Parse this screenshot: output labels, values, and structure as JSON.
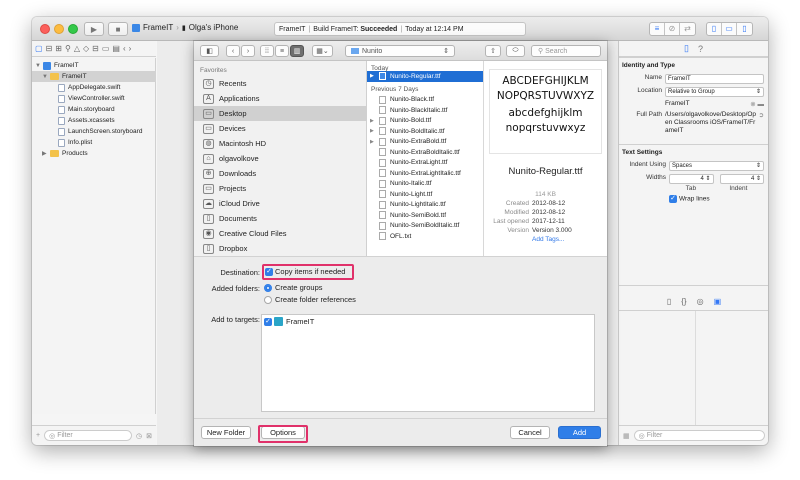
{
  "toolbar": {
    "scheme_app": "FrameIT",
    "scheme_device": "Olga's iPhone",
    "status_project": "FrameIT",
    "status_build": "Build FrameIT: ",
    "status_result": "Succeeded",
    "status_time": "Today at 12:14 PM"
  },
  "navigator": {
    "items": [
      {
        "label": "FrameIT",
        "kind": "project"
      },
      {
        "label": "FrameIT",
        "kind": "folder"
      },
      {
        "label": "AppDelegate.swift",
        "kind": "file"
      },
      {
        "label": "ViewController.swift",
        "kind": "file"
      },
      {
        "label": "Main.storyboard",
        "kind": "file"
      },
      {
        "label": "Assets.xcassets",
        "kind": "file"
      },
      {
        "label": "LaunchScreen.storyboard",
        "kind": "file"
      },
      {
        "label": "Info.plist",
        "kind": "file"
      },
      {
        "label": "Products",
        "kind": "folder"
      }
    ],
    "filter_placeholder": "Filter"
  },
  "sheet": {
    "location": "Nunito",
    "search_placeholder": "Search",
    "sidebar_header": "Favorites",
    "sidebar": [
      "Recents",
      "Applications",
      "Desktop",
      "Devices",
      "Macintosh HD",
      "olgavolkove",
      "Downloads",
      "Projects",
      "iCloud Drive",
      "Documents",
      "Creative Cloud Files",
      "Dropbox"
    ],
    "sidebar_icons": [
      "◷",
      "A",
      "▭",
      "▭",
      "◍",
      "⌂",
      "⊕",
      "▭",
      "☁",
      "▯",
      "◉",
      "▯"
    ],
    "col_today": "Today",
    "col_prev": "Previous 7 Days",
    "today_files": [
      "Nunito-Regular.ttf"
    ],
    "prev_files": [
      "Nunito-Black.ttf",
      "Nunito-BlackItalic.ttf",
      "Nunito-Bold.ttf",
      "Nunito-BoldItalic.ttf",
      "Nunito-ExtraBold.ttf",
      "Nunito-ExtraBoldItalic.ttf",
      "Nunito-ExtraLight.ttf",
      "Nunito-ExtraLightItalic.ttf",
      "Nunito-Italic.ttf",
      "Nunito-Light.ttf",
      "Nunito-LightItalic.ttf",
      "Nunito-SemiBold.ttf",
      "Nunito-SemiBoldItalic.ttf",
      "OFL.txt"
    ],
    "preview": {
      "line1": "ABCDEFGHIJKLM",
      "line2": "NOPQRSTUVWXYZ",
      "line3": "abcdefghijklm",
      "line4": "nopqrstuvwxyz",
      "name": "Nunito-Regular.ttf",
      "size": "114 KB",
      "created_k": "Created",
      "created_v": "2012-08-12",
      "modified_k": "Modified",
      "modified_v": "2012-08-12",
      "opened_k": "Last opened",
      "opened_v": "2017-12-11",
      "version_k": "Version",
      "version_v": "Version 3.000",
      "add_tags": "Add Tags..."
    },
    "options": {
      "destination_label": "Destination:",
      "copy_label": "Copy items if needed",
      "folders_label": "Added folders:",
      "create_groups": "Create groups",
      "create_refs": "Create folder references",
      "targets_label": "Add to targets:",
      "target_name": "FrameIT"
    },
    "buttons": {
      "new_folder": "New Folder",
      "options": "Options",
      "cancel": "Cancel",
      "add": "Add"
    }
  },
  "inspector": {
    "section1": "Identity and Type",
    "name_label": "Name",
    "name_value": "FrameIT",
    "location_label": "Location",
    "location_value": "Relative to Group",
    "location_name": "FrameIT",
    "fullpath_label": "Full Path",
    "fullpath_value": "/Users/olgavolkove/Desktop/Open Classrooms iOS/FrameIT/FrameIT",
    "section2": "Text Settings",
    "indent_label": "Indent Using",
    "indent_value": "Spaces",
    "widths_label": "Widths",
    "tab_value": "4",
    "indent_num": "4",
    "tab_label": "Tab",
    "indent_sub": "Indent",
    "wrap_label": "Wrap lines",
    "filter_placeholder": "Filter"
  }
}
